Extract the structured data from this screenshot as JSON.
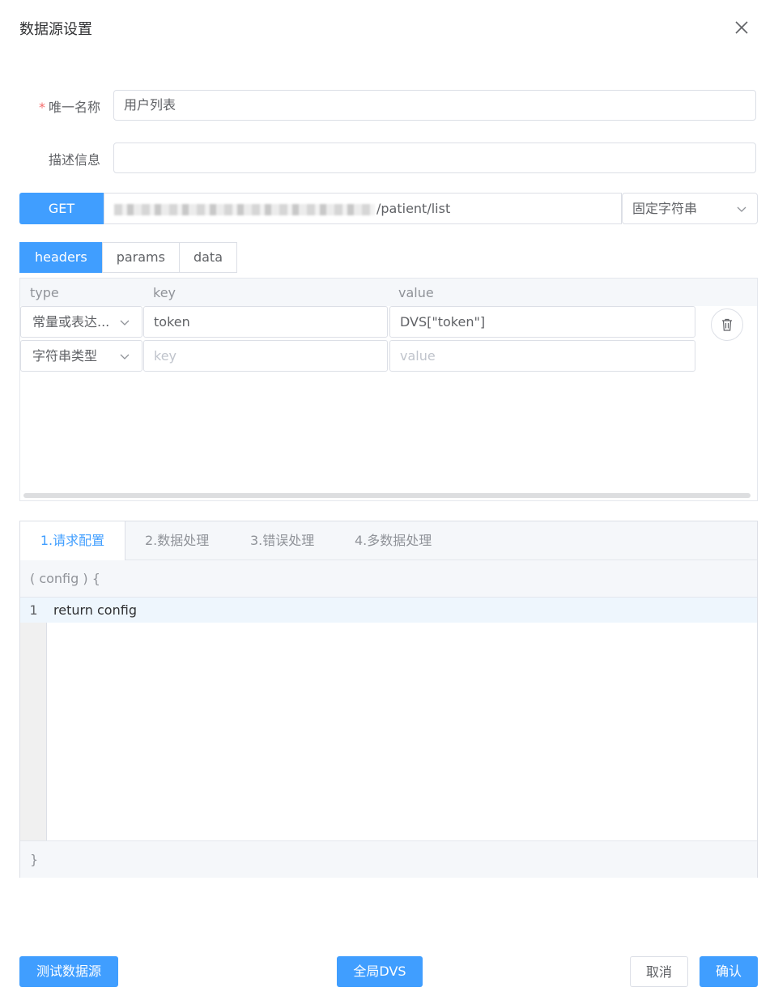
{
  "dialog": {
    "title": "数据源设置",
    "close_icon": "close-icon"
  },
  "form": {
    "name_label": "唯一名称",
    "name_required_mark": "*",
    "name_value": "用户列表",
    "desc_label": "描述信息",
    "desc_value": ""
  },
  "request": {
    "method": "GET",
    "url_visible_suffix": "/patient/list",
    "url_prefix_obscured": true,
    "url_type": "固定字符串"
  },
  "config_tabs": [
    {
      "label": "headers",
      "active": true
    },
    {
      "label": "params",
      "active": false
    },
    {
      "label": "data",
      "active": false
    }
  ],
  "table": {
    "columns": [
      "type",
      "key",
      "value"
    ],
    "rows": [
      {
        "type": "常量或表达...",
        "key": "token",
        "value": "DVS[\"token\"]"
      },
      {
        "type": "字符串类型",
        "key": "",
        "value": ""
      }
    ],
    "placeholders": {
      "key": "key",
      "value": "value"
    }
  },
  "code_tabs": [
    {
      "label": "1.请求配置",
      "active": true
    },
    {
      "label": "2.数据处理",
      "active": false
    },
    {
      "label": "3.错误处理",
      "active": false
    },
    {
      "label": "4.多数据处理",
      "active": false
    }
  ],
  "editor": {
    "signature": "( config ) {",
    "lines": [
      {
        "number": "1",
        "code": "return config"
      }
    ],
    "closing": "}"
  },
  "footer": {
    "test_label": "测试数据源",
    "global_label": "全局DVS",
    "cancel_label": "取消",
    "confirm_label": "确认"
  },
  "colors": {
    "primary": "#409eff",
    "required": "#f56c6c",
    "border": "#dcdfe6"
  }
}
